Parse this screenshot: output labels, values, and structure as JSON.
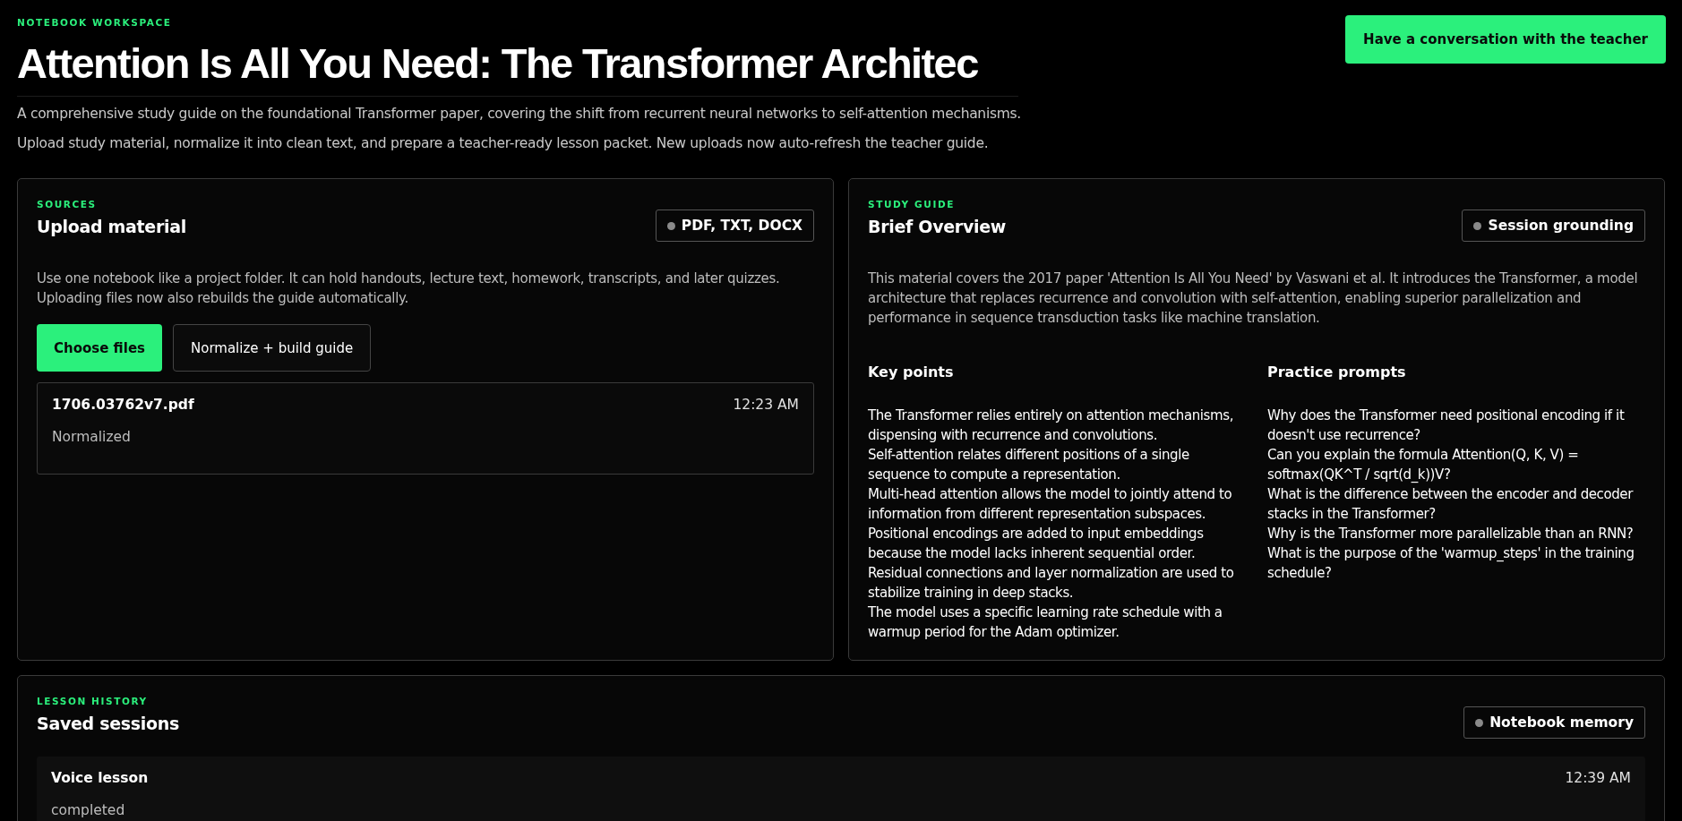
{
  "header": {
    "eyebrow": "NOTEBOOK WORKSPACE",
    "title": "Attention Is All You Need: The Transformer Architec",
    "descriptions": [
      "A comprehensive study guide on the foundational Transformer paper, covering the shift from recurrent neural networks to self-attention mechanisms.",
      "Upload study material, normalize it into clean text, and prepare a teacher-ready lesson packet. New uploads now auto-refresh the teacher guide."
    ],
    "action_button": "Have a conversation with the teacher"
  },
  "sources": {
    "eyebrow": "SOURCES",
    "title": "Upload material",
    "badge": "PDF, TXT, DOCX",
    "description": "Use one notebook like a project folder. It can hold handouts, lecture text, homework, transcripts, and later quizzes. Uploading files now also rebuilds the guide automatically.",
    "buttons": [
      {
        "label": "Choose files",
        "kind": "primary"
      },
      {
        "label": "Normalize + build guide",
        "kind": "secondary"
      }
    ],
    "files": [
      {
        "name": "1706.03762v7.pdf",
        "time": "12:23 AM",
        "status": "Normalized"
      }
    ]
  },
  "study_guide": {
    "eyebrow": "STUDY GUIDE",
    "title": "Brief Overview",
    "badge": "Session grounding",
    "overview": "This material covers the 2017 paper 'Attention Is All You Need' by Vaswani et al. It introduces the Transformer, a model architecture that replaces recurrence and convolution with self-attention, enabling superior parallelization and performance in sequence transduction tasks like machine translation.",
    "key_points": {
      "heading": "Key points",
      "items": [
        "The Transformer relies entirely on attention mechanisms, dispensing with recurrence and convolutions.",
        "Self-attention relates different positions of a single sequence to compute a representation.",
        "Multi-head attention allows the model to jointly attend to information from different representation subspaces.",
        "Positional encodings are added to input embeddings because the model lacks inherent sequential order.",
        "Residual connections and layer normalization are used to stabilize training in deep stacks.",
        "The model uses a specific learning rate schedule with a warmup period for the Adam optimizer."
      ]
    },
    "practice_prompts": {
      "heading": "Practice prompts",
      "items": [
        "Why does the Transformer need positional encoding if it doesn't use recurrence?",
        "Can you explain the formula Attention(Q, K, V) = softmax(QK^T / sqrt(d_k))V?",
        "What is the difference between the encoder and decoder stacks in the Transformer?",
        "Why is the Transformer more parallelizable than an RNN?",
        "What is the purpose of the 'warmup_steps' in the training schedule?"
      ]
    }
  },
  "lesson_history": {
    "eyebrow": "LESSON HISTORY",
    "title": "Saved sessions",
    "badge": "Notebook memory",
    "sessions": [
      {
        "title": "Voice lesson",
        "time": "12:39 AM",
        "status": "completed"
      }
    ]
  }
}
